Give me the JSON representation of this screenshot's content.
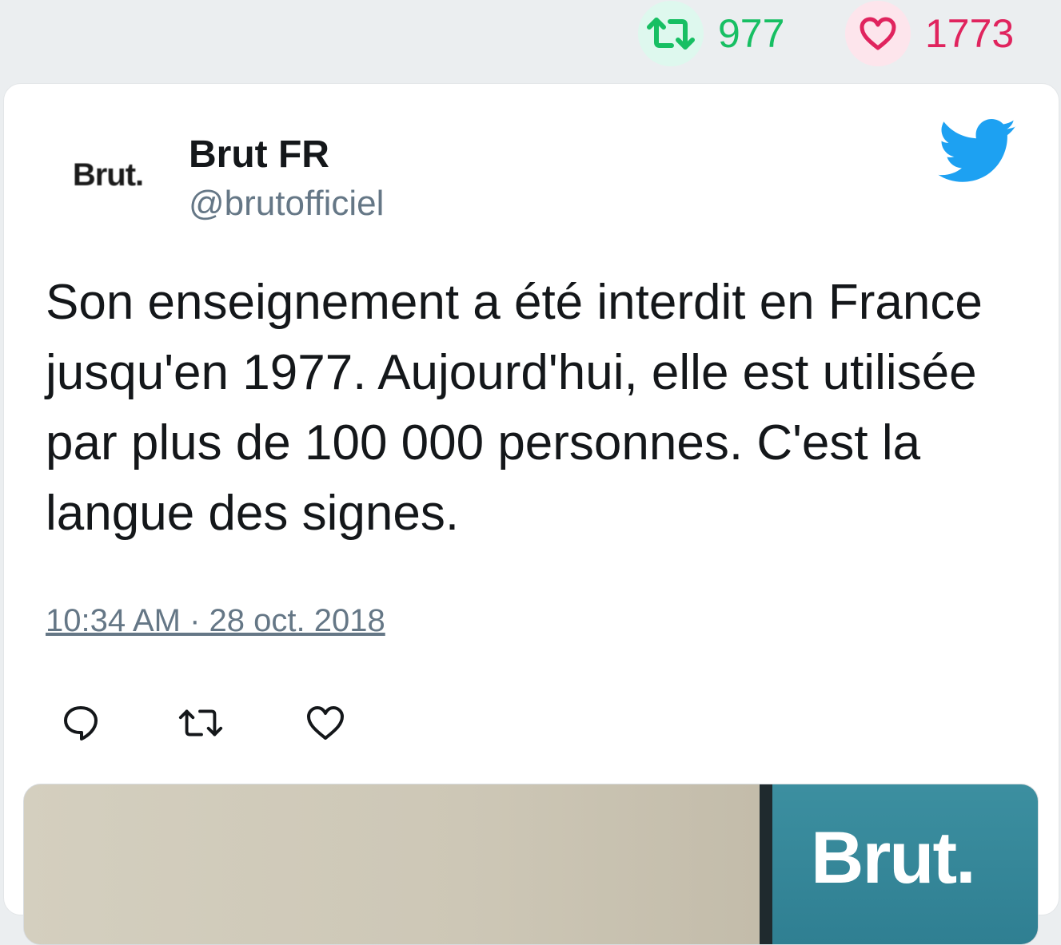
{
  "stats": {
    "retweet_count": "977",
    "like_count": "1773",
    "retweet_icon": "retweet-icon",
    "like_icon": "heart-icon"
  },
  "tweet": {
    "author_name": "Brut FR",
    "author_handle": "@brutofficiel",
    "avatar_logo": "Brut.",
    "text": "Son enseignement a été interdit en France jusqu'en 1977. Aujourd'hui, elle est utilisée par plus de 100 000 personnes. C'est la langue des signes.",
    "timestamp": "10:34 AM · 28 oct. 2018"
  },
  "media": {
    "logo_text": "Brut."
  },
  "colors": {
    "retweet_green": "#17bf63",
    "like_pink": "#e0245e",
    "twitter_blue": "#1da1f2",
    "secondary_text": "#657786"
  }
}
